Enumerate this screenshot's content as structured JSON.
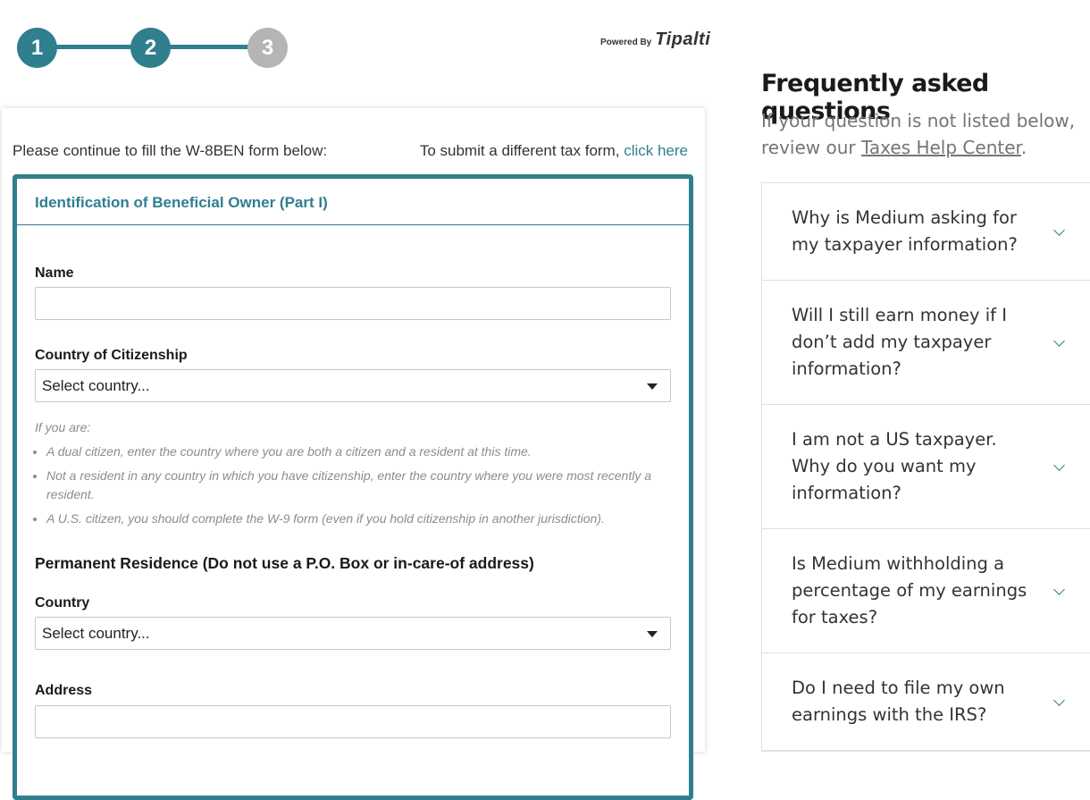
{
  "stepper": {
    "steps": [
      "1",
      "2",
      "3"
    ]
  },
  "branding": {
    "powered_by": "Powered By",
    "logo_text": "Tipalti"
  },
  "form": {
    "intro": "Please continue to fill the W-8BEN form below:",
    "different_form_text": "To submit a different tax form,",
    "different_form_link": "click here",
    "panel_title": "Identification of Beneficial Owner (Part I)",
    "name_label": "Name",
    "name_value": "",
    "citizenship_label": "Country of Citizenship",
    "citizenship_value": "Select country...",
    "help_intro": "If you are:",
    "help_items": [
      "A dual citizen, enter the country where you are both a citizen and a resident at this time.",
      "Not a resident in any country in which you have citizenship, enter the country where you were most recently a resident.",
      "A U.S. citizen, you should complete the W-9 form (even if you hold citizenship in another jurisdiction)."
    ],
    "residence_title": "Permanent Residence (Do not use a P.O. Box or in-care-of address)",
    "country_label": "Country",
    "country_value": "Select country...",
    "address_label": "Address",
    "address_value": ""
  },
  "faq": {
    "title": "Frequently asked questions",
    "subtitle_prefix": "If your question is not listed below, review our ",
    "help_center_link": "Taxes Help Center",
    "subtitle_suffix": ".",
    "items": [
      "Why is Medium asking for my taxpayer information?",
      "Will I still earn money if I don’t add my taxpayer information?",
      "I am not a US taxpayer. Why do you want my information?",
      "Is Medium withholding a percentage of my earnings for taxes?",
      "Do I need to file my own earnings with the IRS?"
    ]
  },
  "colors": {
    "accent": "#2f7f8e",
    "inactive_step": "#b5b5b5",
    "logo_accent": "#e23b3b"
  }
}
